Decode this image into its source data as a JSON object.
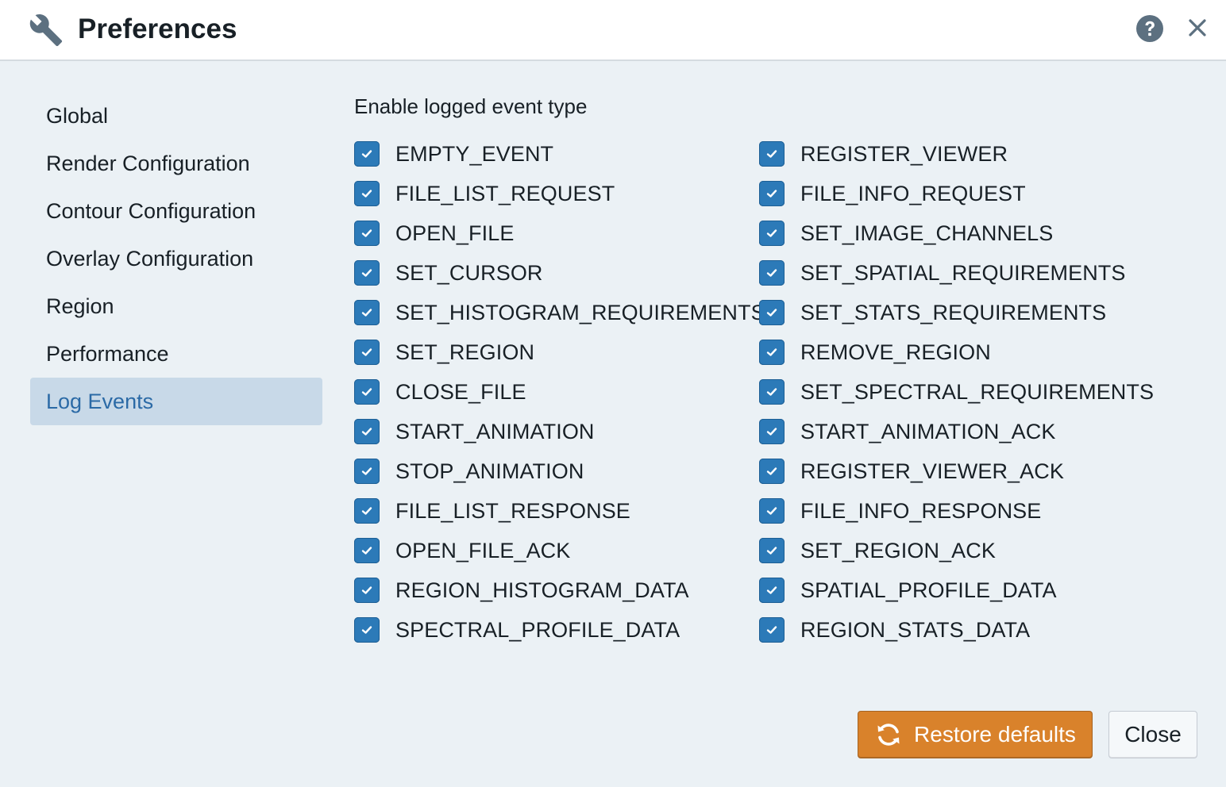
{
  "window": {
    "title": "Preferences",
    "title_icon": "wrench-icon",
    "help_icon": "help-circle-icon",
    "close_icon": "close-icon"
  },
  "sidebar": {
    "items": [
      {
        "label": "Global",
        "active": false
      },
      {
        "label": "Render Configuration",
        "active": false
      },
      {
        "label": "Contour Configuration",
        "active": false
      },
      {
        "label": "Overlay Configuration",
        "active": false
      },
      {
        "label": "Region",
        "active": false
      },
      {
        "label": "Performance",
        "active": false
      },
      {
        "label": "Log Events",
        "active": true
      }
    ]
  },
  "main": {
    "heading": "Enable logged event type",
    "left_events": [
      {
        "label": "EMPTY_EVENT",
        "checked": true
      },
      {
        "label": "FILE_LIST_REQUEST",
        "checked": true
      },
      {
        "label": "OPEN_FILE",
        "checked": true
      },
      {
        "label": "SET_CURSOR",
        "checked": true
      },
      {
        "label": "SET_HISTOGRAM_REQUIREMENTS",
        "checked": true
      },
      {
        "label": "SET_REGION",
        "checked": true
      },
      {
        "label": "CLOSE_FILE",
        "checked": true
      },
      {
        "label": "START_ANIMATION",
        "checked": true
      },
      {
        "label": "STOP_ANIMATION",
        "checked": true
      },
      {
        "label": "FILE_LIST_RESPONSE",
        "checked": true
      },
      {
        "label": "OPEN_FILE_ACK",
        "checked": true
      },
      {
        "label": "REGION_HISTOGRAM_DATA",
        "checked": true
      },
      {
        "label": "SPECTRAL_PROFILE_DATA",
        "checked": true
      }
    ],
    "right_events": [
      {
        "label": "REGISTER_VIEWER",
        "checked": true
      },
      {
        "label": "FILE_INFO_REQUEST",
        "checked": true
      },
      {
        "label": "SET_IMAGE_CHANNELS",
        "checked": true
      },
      {
        "label": "SET_SPATIAL_REQUIREMENTS",
        "checked": true
      },
      {
        "label": "SET_STATS_REQUIREMENTS",
        "checked": true
      },
      {
        "label": "REMOVE_REGION",
        "checked": true
      },
      {
        "label": "SET_SPECTRAL_REQUIREMENTS",
        "checked": true
      },
      {
        "label": "START_ANIMATION_ACK",
        "checked": true
      },
      {
        "label": "REGISTER_VIEWER_ACK",
        "checked": true
      },
      {
        "label": "FILE_INFO_RESPONSE",
        "checked": true
      },
      {
        "label": "SET_REGION_ACK",
        "checked": true
      },
      {
        "label": "SPATIAL_PROFILE_DATA",
        "checked": true
      },
      {
        "label": "REGION_STATS_DATA",
        "checked": true
      }
    ]
  },
  "footer": {
    "restore_label": "Restore defaults",
    "restore_icon": "refresh-icon",
    "close_label": "Close"
  },
  "colors": {
    "accent": "#2c7ab8",
    "warning_button": "#d9822b",
    "active_nav_bg": "#c8d9e8",
    "active_nav_text": "#2b6aa6",
    "panel_bg": "#ebf1f5"
  }
}
